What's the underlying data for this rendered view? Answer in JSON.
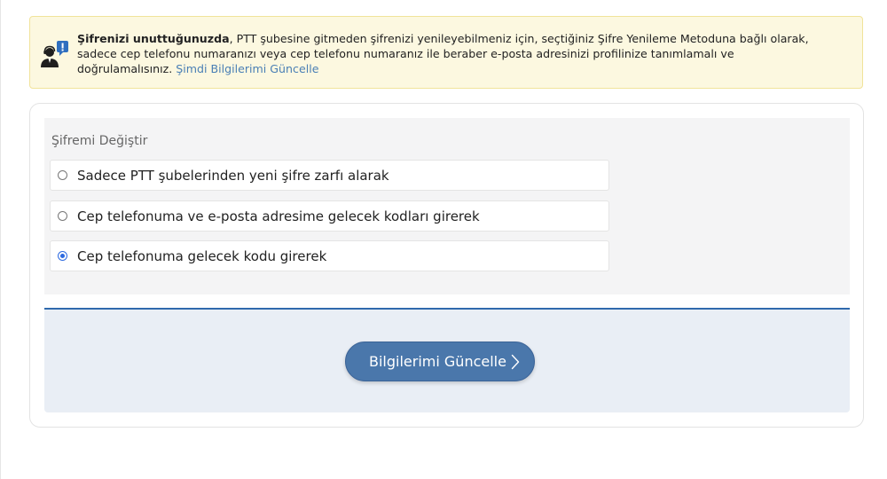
{
  "notice": {
    "icon": "support-agent-alert-icon",
    "bold": "Şifrenizi unuttuğunuzda",
    "text": ", PTT şubesine gitmeden şifrenizi yenileyebilmeniz için, seçtiğiniz Şifre Yenileme Metoduna bağlı olarak, sadece cep telefonu numaranızı veya cep telefonu numaranız ile beraber e-posta adresinizi profilinize tanımlamalı ve doğrulamalısınız. ",
    "link": "Şimdi Bilgilerimi Güncelle"
  },
  "form": {
    "title": "Şifremi Değiştir",
    "options": [
      {
        "label": "Sadece PTT şubelerinden yeni şifre zarfı alarak",
        "selected": false
      },
      {
        "label": "Cep telefonuma ve e-posta adresime gelecek kodları girerek",
        "selected": false
      },
      {
        "label": "Cep telefonuma gelecek kodu girerek",
        "selected": true
      }
    ],
    "submit_label": "Bilgilerimi Güncelle",
    "submit_icon": "chevron-right-icon"
  },
  "colors": {
    "accent": "#4a77ab",
    "divider": "#2f69ad",
    "notice_bg": "#fcf8e0",
    "link": "#4a7fb5",
    "radio_checked": "#2d6ae0"
  }
}
